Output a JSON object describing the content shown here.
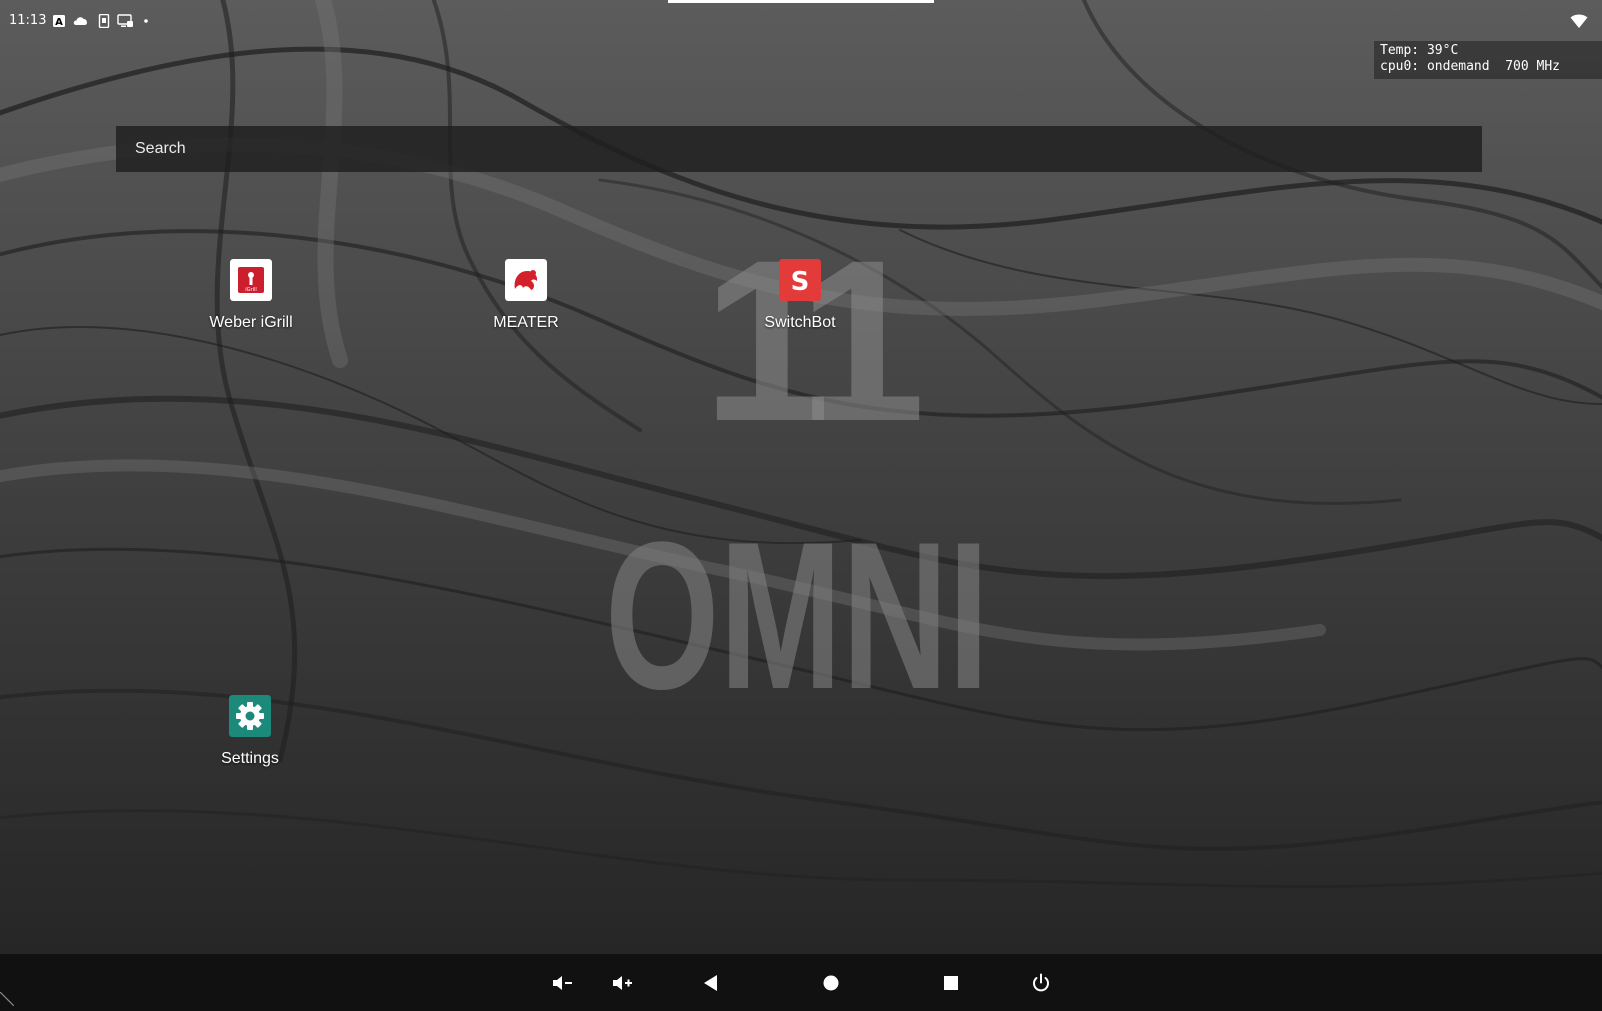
{
  "status_bar": {
    "time": "11:13",
    "icons": [
      "text-a-icon",
      "cloud-icon",
      "sim-card-icon",
      "cast-icon",
      "dot-icon"
    ],
    "right_icons": [
      "wifi-icon"
    ]
  },
  "cpu_overlay": {
    "line1": "Temp: 39°C",
    "line2": "cpu0: ondemand  700 MHz"
  },
  "wallpaper": {
    "number": "11",
    "brand": "OMNI"
  },
  "search": {
    "placeholder": "Search"
  },
  "apps": [
    {
      "label": "Weber iGrill",
      "icon": "weber-igrill-icon",
      "color": "#cc1f2d"
    },
    {
      "label": "MEATER",
      "icon": "meater-icon",
      "color": "#d4202b"
    },
    {
      "label": "SwitchBot",
      "icon": "switchbot-icon",
      "color": "#e33a3a"
    },
    {
      "label": "Settings",
      "icon": "settings-gear-icon",
      "color": "#1b8a7a"
    }
  ],
  "nav_bar": {
    "buttons": [
      "volume-down-icon",
      "volume-up-icon",
      "back-icon",
      "home-icon",
      "recents-icon",
      "power-icon"
    ]
  }
}
